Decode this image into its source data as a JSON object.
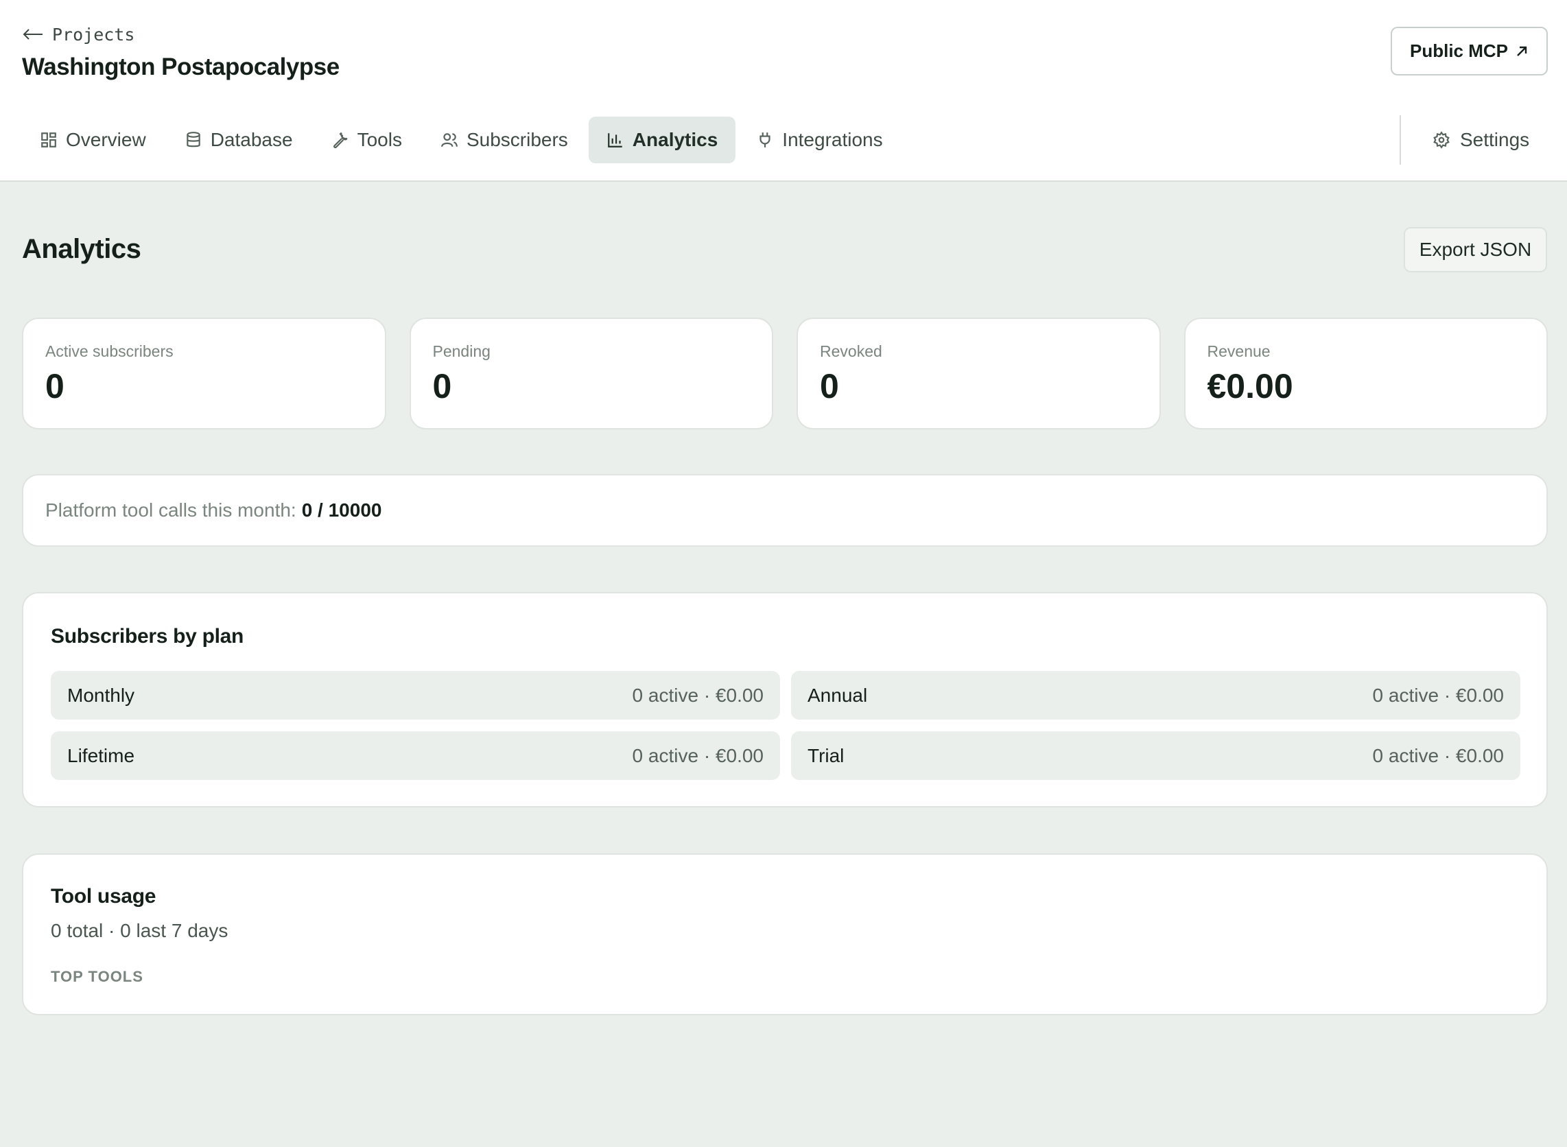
{
  "header": {
    "back_label": "Projects",
    "project_title": "Washington Postapocalypse",
    "public_mcp_label": "Public MCP"
  },
  "nav": {
    "tabs": [
      {
        "label": "Overview",
        "icon": "grid-icon"
      },
      {
        "label": "Database",
        "icon": "database-icon"
      },
      {
        "label": "Tools",
        "icon": "wrench-icon"
      },
      {
        "label": "Subscribers",
        "icon": "users-icon"
      },
      {
        "label": "Analytics",
        "icon": "bar-chart-icon",
        "active": true
      },
      {
        "label": "Integrations",
        "icon": "plug-icon"
      }
    ],
    "settings_label": "Settings"
  },
  "page": {
    "title": "Analytics",
    "export_label": "Export JSON"
  },
  "stats": [
    {
      "label": "Active subscribers",
      "value": "0"
    },
    {
      "label": "Pending",
      "value": "0"
    },
    {
      "label": "Revoked",
      "value": "0"
    },
    {
      "label": "Revenue",
      "value": "€0.00"
    }
  ],
  "calls": {
    "label": "Platform tool calls this month:",
    "value": "0 / 10000"
  },
  "plans": {
    "title": "Subscribers by plan",
    "items": [
      {
        "name": "Monthly",
        "meta": "0 active · €0.00"
      },
      {
        "name": "Annual",
        "meta": "0 active · €0.00"
      },
      {
        "name": "Lifetime",
        "meta": "0 active · €0.00"
      },
      {
        "name": "Trial",
        "meta": "0 active · €0.00"
      }
    ]
  },
  "usage": {
    "title": "Tool usage",
    "summary": "0 total · 0 last 7 days",
    "top_tools_label": "TOP TOOLS"
  }
}
